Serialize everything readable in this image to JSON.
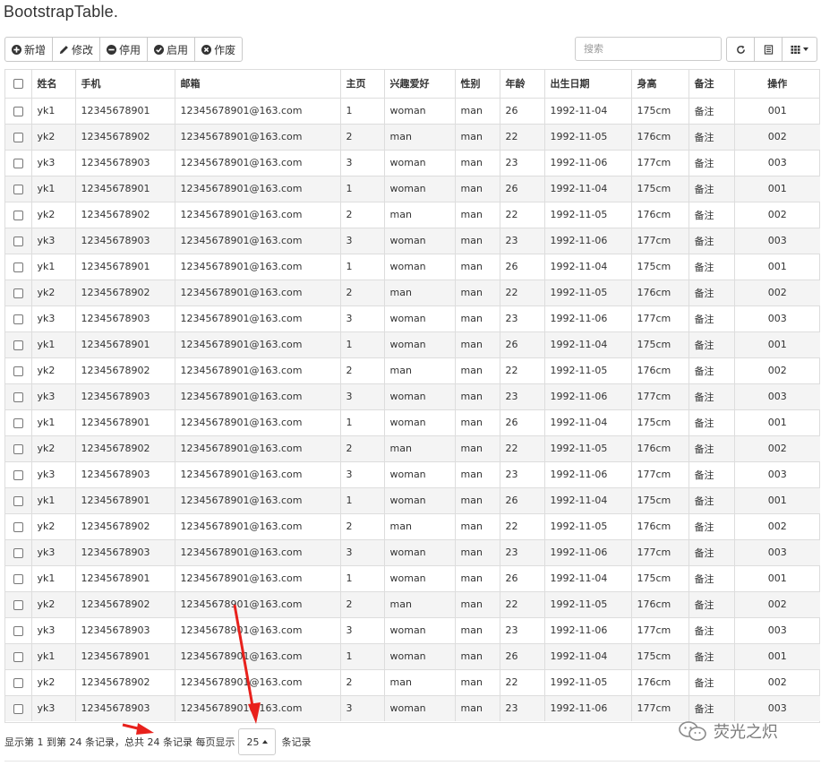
{
  "title": "BootstrapTable.",
  "toolbar": {
    "add_label": "新增",
    "edit_label": "修改",
    "disable_label": "停用",
    "enable_label": "启用",
    "void_label": "作废"
  },
  "search": {
    "placeholder": "搜索",
    "value": ""
  },
  "icons": {
    "add": "plus-circle-icon",
    "edit": "pencil-icon",
    "disable": "minus-circle-icon",
    "enable": "check-circle-icon",
    "void": "x-circle-icon",
    "refresh": "refresh-icon",
    "toggle": "list-view-icon",
    "columns": "columns-grid-icon",
    "watermark": "wechat-icon"
  },
  "table": {
    "headers": [
      "姓名",
      "手机",
      "邮箱",
      "主页",
      "兴趣爱好",
      "性别",
      "年龄",
      "出生日期",
      "身高",
      "备注",
      "操作"
    ],
    "rows": [
      [
        "yk1",
        "12345678901",
        "12345678901@163.com",
        "1",
        "woman",
        "man",
        "26",
        "1992-11-04",
        "175cm",
        "备注",
        "001"
      ],
      [
        "yk2",
        "12345678902",
        "12345678901@163.com",
        "2",
        "man",
        "man",
        "22",
        "1992-11-05",
        "176cm",
        "备注",
        "002"
      ],
      [
        "yk3",
        "12345678903",
        "12345678901@163.com",
        "3",
        "woman",
        "man",
        "23",
        "1992-11-06",
        "177cm",
        "备注",
        "003"
      ],
      [
        "yk1",
        "12345678901",
        "12345678901@163.com",
        "1",
        "woman",
        "man",
        "26",
        "1992-11-04",
        "175cm",
        "备注",
        "001"
      ],
      [
        "yk2",
        "12345678902",
        "12345678901@163.com",
        "2",
        "man",
        "man",
        "22",
        "1992-11-05",
        "176cm",
        "备注",
        "002"
      ],
      [
        "yk3",
        "12345678903",
        "12345678901@163.com",
        "3",
        "woman",
        "man",
        "23",
        "1992-11-06",
        "177cm",
        "备注",
        "003"
      ],
      [
        "yk1",
        "12345678901",
        "12345678901@163.com",
        "1",
        "woman",
        "man",
        "26",
        "1992-11-04",
        "175cm",
        "备注",
        "001"
      ],
      [
        "yk2",
        "12345678902",
        "12345678901@163.com",
        "2",
        "man",
        "man",
        "22",
        "1992-11-05",
        "176cm",
        "备注",
        "002"
      ],
      [
        "yk3",
        "12345678903",
        "12345678901@163.com",
        "3",
        "woman",
        "man",
        "23",
        "1992-11-06",
        "177cm",
        "备注",
        "003"
      ],
      [
        "yk1",
        "12345678901",
        "12345678901@163.com",
        "1",
        "woman",
        "man",
        "26",
        "1992-11-04",
        "175cm",
        "备注",
        "001"
      ],
      [
        "yk2",
        "12345678902",
        "12345678901@163.com",
        "2",
        "man",
        "man",
        "22",
        "1992-11-05",
        "176cm",
        "备注",
        "002"
      ],
      [
        "yk3",
        "12345678903",
        "12345678901@163.com",
        "3",
        "woman",
        "man",
        "23",
        "1992-11-06",
        "177cm",
        "备注",
        "003"
      ],
      [
        "yk1",
        "12345678901",
        "12345678901@163.com",
        "1",
        "woman",
        "man",
        "26",
        "1992-11-04",
        "175cm",
        "备注",
        "001"
      ],
      [
        "yk2",
        "12345678902",
        "12345678901@163.com",
        "2",
        "man",
        "man",
        "22",
        "1992-11-05",
        "176cm",
        "备注",
        "002"
      ],
      [
        "yk3",
        "12345678903",
        "12345678901@163.com",
        "3",
        "woman",
        "man",
        "23",
        "1992-11-06",
        "177cm",
        "备注",
        "003"
      ],
      [
        "yk1",
        "12345678901",
        "12345678901@163.com",
        "1",
        "woman",
        "man",
        "26",
        "1992-11-04",
        "175cm",
        "备注",
        "001"
      ],
      [
        "yk2",
        "12345678902",
        "12345678901@163.com",
        "2",
        "man",
        "man",
        "22",
        "1992-11-05",
        "176cm",
        "备注",
        "002"
      ],
      [
        "yk3",
        "12345678903",
        "12345678901@163.com",
        "3",
        "woman",
        "man",
        "23",
        "1992-11-06",
        "177cm",
        "备注",
        "003"
      ],
      [
        "yk1",
        "12345678901",
        "12345678901@163.com",
        "1",
        "woman",
        "man",
        "26",
        "1992-11-04",
        "175cm",
        "备注",
        "001"
      ],
      [
        "yk2",
        "12345678902",
        "12345678901@163.com",
        "2",
        "man",
        "man",
        "22",
        "1992-11-05",
        "176cm",
        "备注",
        "002"
      ],
      [
        "yk3",
        "12345678903",
        "12345678901@163.com",
        "3",
        "woman",
        "man",
        "23",
        "1992-11-06",
        "177cm",
        "备注",
        "003"
      ],
      [
        "yk1",
        "12345678901",
        "12345678901@163.com",
        "1",
        "woman",
        "man",
        "26",
        "1992-11-04",
        "175cm",
        "备注",
        "001"
      ],
      [
        "yk2",
        "12345678902",
        "12345678901@163.com",
        "2",
        "man",
        "man",
        "22",
        "1992-11-05",
        "176cm",
        "备注",
        "002"
      ],
      [
        "yk3",
        "12345678903",
        "12345678901@163.com",
        "3",
        "woman",
        "man",
        "23",
        "1992-11-06",
        "177cm",
        "备注",
        "003"
      ]
    ]
  },
  "pagination": {
    "summary": "显示第 1 到第 24 条记录，总共 24 条记录 每页显示",
    "page_size": "25",
    "suffix": "条记录"
  },
  "watermark": {
    "text": "荧光之炽"
  },
  "colors": {
    "annotation_arrow": "#e8211c",
    "border": "#dddddd",
    "stripe": "#f4f4f4"
  }
}
